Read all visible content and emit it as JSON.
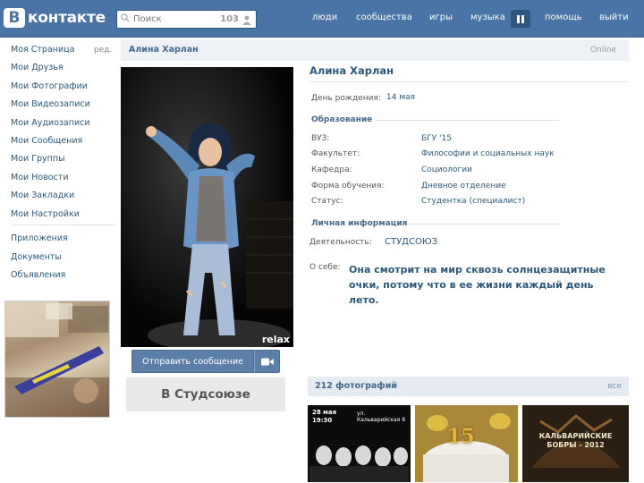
{
  "header": {
    "logo_letter": "В",
    "logo_text": "контакте",
    "search_placeholder": "Поиск",
    "search_count": "103",
    "nav": [
      "люди",
      "сообщества",
      "игры",
      "музыка",
      "помощь",
      "выйти"
    ]
  },
  "sidebar": {
    "edit_label": "ред.",
    "items": [
      {
        "label": "Моя Страница"
      },
      {
        "label": "Мои Друзья"
      },
      {
        "label": "Мои Фотографии"
      },
      {
        "label": "Мои Видеозаписи"
      },
      {
        "label": "Мои Аудиозаписи"
      },
      {
        "label": "Мои Сообщения"
      },
      {
        "label": "Мои Группы"
      },
      {
        "label": "Мои Новости"
      },
      {
        "label": "Мои Закладки"
      },
      {
        "label": "Мои Настройки"
      },
      {
        "label": "Приложения"
      },
      {
        "label": "Документы"
      },
      {
        "label": "Объявления"
      }
    ]
  },
  "title_bar": {
    "name": "Алина Харлан",
    "status": "Online"
  },
  "profile": {
    "name": "Алина Харлан",
    "photo_watermark": "relax",
    "send_message": "Отправить сообщение",
    "community": "В Студсоюзе",
    "birthday_label": "День рождения:",
    "birthday_value": "14 мая",
    "education_title": "Образование",
    "education": [
      {
        "label": "ВУЗ:",
        "value": "БГУ '15"
      },
      {
        "label": "Факультет:",
        "value": "Философии и социальных наук"
      },
      {
        "label": "Кафедра:",
        "value": "Социологии"
      },
      {
        "label": "Форма обучения:",
        "value": "Дневное отделение"
      },
      {
        "label": "Статус:",
        "value": "Студентка (специалист)"
      }
    ],
    "personal_title": "Личная информация",
    "activity_label": "Деятельность:",
    "activity_value": "СТУДСОЮЗ",
    "about_label": "О себе:",
    "about_text": "Она смотрит на мир сквозь солнцезащитные очки, потому что в ее жизни каждый день лето."
  },
  "photos": {
    "count_label": "212 фотографий",
    "all_label": "все",
    "thumb1_date": "28 мая",
    "thumb1_time": "19:30",
    "thumb1_addr": "ул. Кальварийская 8",
    "thumb2_number": "15",
    "thumb3_text": "КАЛЬВАРИЙСКИЕ БОБРЫ - 2012"
  },
  "colors": {
    "header_bg": "#4a74a5",
    "link": "#2b587a",
    "button": "#5b7fa6"
  }
}
